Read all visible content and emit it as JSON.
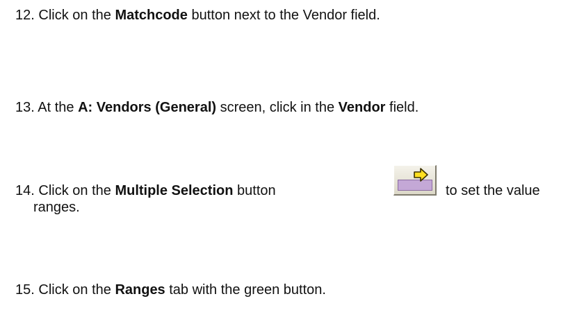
{
  "steps": [
    {
      "number": "12.",
      "pre": "Click on the",
      "bold": "Matchcode",
      "post": "button next to the Vendor field."
    },
    {
      "number": "13.",
      "pre": "At the",
      "bold": "A: Vendors (General)",
      "mid": "screen, click in the",
      "bold2": "Vendor",
      "post": "field."
    },
    {
      "number": "14.",
      "pre": "Click on the",
      "bold": "Multiple Selection",
      "mid": "button",
      "post": "to set the value",
      "cont": "ranges.",
      "icon": "multiple-selection-arrow-icon"
    },
    {
      "number": "15.",
      "pre": "Click on the",
      "bold": "Ranges",
      "post": "tab with the green button."
    }
  ]
}
